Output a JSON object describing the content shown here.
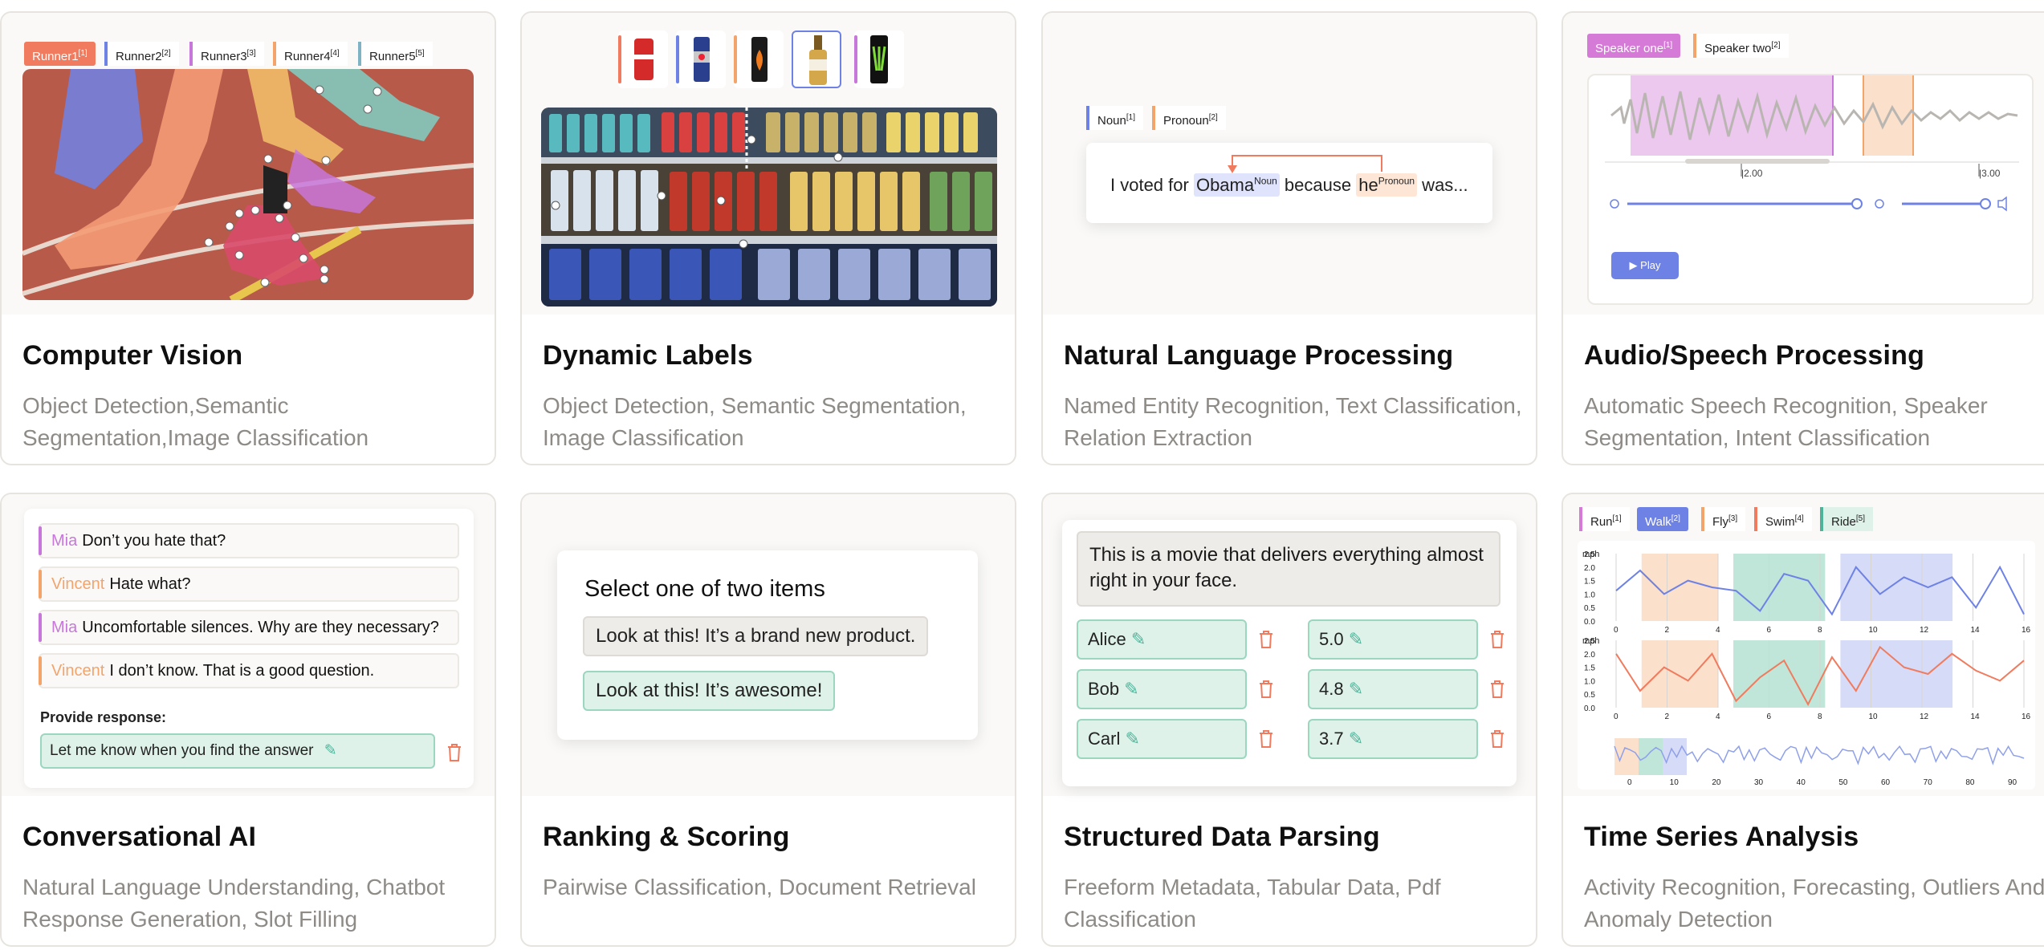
{
  "cards": [
    {
      "title": "Computer Vision",
      "description": "Object Detection,Semantic Segmentation,Image Classification",
      "tags": [
        {
          "label": "Runner1",
          "sup": "[1]",
          "color": "#f07b5e",
          "active": true
        },
        {
          "label": "Runner2",
          "sup": "[2]",
          "color": "#6e82e6"
        },
        {
          "label": "Runner3",
          "sup": "[3]",
          "color": "#c777d9"
        },
        {
          "label": "Runner4",
          "sup": "[4]",
          "color": "#f3a46b"
        },
        {
          "label": "Runner5",
          "sup": "[5]",
          "color": "#7fb3c3"
        }
      ]
    },
    {
      "title": "Dynamic Labels",
      "description": "Object Detection, Semantic Segmentation, Image Classification",
      "products": [
        "coca-cola can",
        "red bull can",
        "burn can",
        "beer bottle",
        "monster can"
      ]
    },
    {
      "title": "Natural Language Processing",
      "description": "Named Entity Recognition, Text Classification, Relation Extraction",
      "tags": [
        {
          "label": "Noun",
          "sup": "[1]",
          "color": "#6e82e6"
        },
        {
          "label": "Pronoun",
          "sup": "[2]",
          "color": "#f3a46b"
        }
      ],
      "sentence": {
        "before": "I voted for ",
        "entity1": "Obama",
        "entity1_tag": "Noun",
        "middle": " because ",
        "entity2": "he",
        "entity2_tag": "Pronoun",
        "after": " was..."
      }
    },
    {
      "title": "Audio/Speech Processing",
      "description": "Automatic Speech Recognition, Speaker Segmentation, Intent Classification",
      "tags": [
        {
          "label": "Speaker one",
          "sup": "[1]",
          "color": "#d67ad8",
          "active": true
        },
        {
          "label": "Speaker two",
          "sup": "[2]",
          "color": "#f3a46b"
        }
      ],
      "ticks": [
        "|2.00",
        "|3.00"
      ],
      "play_label": "Play"
    },
    {
      "title": "Conversational AI",
      "description": "Natural Language Understanding, Chatbot Response Generation, Slot Filling",
      "messages": [
        {
          "speaker": "Mia",
          "text": "Don’t you hate that?",
          "color": "#c777d9"
        },
        {
          "speaker": "Vincent",
          "text": "Hate what?",
          "color": "#f3a46b"
        },
        {
          "speaker": "Mia",
          "text": "Uncomfortable silences. Why are they necessary?",
          "color": "#c777d9"
        },
        {
          "speaker": "Vincent",
          "text": "I don’t know. That is a good question.",
          "color": "#f3a46b"
        }
      ],
      "response_label": "Provide response:",
      "response_value": "Let me know when you find the answer"
    },
    {
      "title": "Ranking & Scoring",
      "description": "Pairwise Classification, Document Retrieval",
      "prompt": "Select one of two items",
      "items": [
        "Look at this! It’s a brand new product.",
        "Look at this! It’s awesome!"
      ]
    },
    {
      "title": "Structured Data Parsing",
      "description": "Freeform Metadata, Tabular Data, Pdf Classification",
      "text": "This is a movie that delivers everything almost right in your face.",
      "rows": [
        {
          "name": "Alice",
          "score": "5.0"
        },
        {
          "name": "Bob",
          "score": "4.8"
        },
        {
          "name": "Carl",
          "score": "3.7"
        }
      ]
    },
    {
      "title": "Time Series Analysis",
      "description": "Activity Recognition, Forecasting, Outliers And Anomaly Detection",
      "tags": [
        {
          "label": "Run",
          "sup": "[1]",
          "color": "#d67ad8"
        },
        {
          "label": "Walk",
          "sup": "[2]",
          "color": "#6e82e6",
          "active": true
        },
        {
          "label": "Fly",
          "sup": "[3]",
          "color": "#f3a46b"
        },
        {
          "label": "Swim",
          "sup": "[4]",
          "color": "#f07b5e"
        },
        {
          "label": "Ride",
          "sup": "[5]",
          "color": "#4fb39a"
        }
      ],
      "unit": "mph",
      "y_ticks": [
        "2.5",
        "2.0",
        "1.5",
        "1.0",
        "0.5",
        "0.0"
      ],
      "x_ticks": [
        "0",
        "2",
        "4",
        "6",
        "8",
        "10",
        "12",
        "14",
        "16"
      ],
      "overview_ticks": [
        "0",
        "10",
        "20",
        "30",
        "40",
        "50",
        "60",
        "70",
        "80",
        "90"
      ]
    }
  ],
  "colors": {
    "accent_blue": "#6e82e6",
    "green_field": "#dff2ea",
    "trash_red": "#f07b5e",
    "desc_gray": "#8e8b87"
  }
}
